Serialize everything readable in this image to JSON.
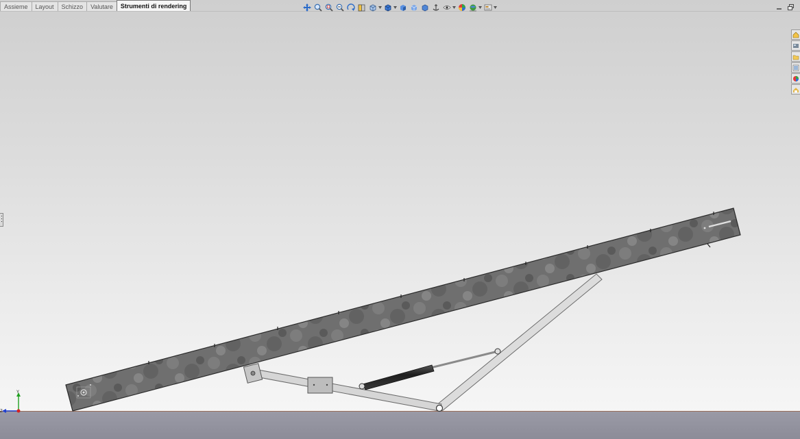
{
  "tabs": [
    {
      "label": "Assieme",
      "active": false
    },
    {
      "label": "Layout",
      "active": false
    },
    {
      "label": "Schizzo",
      "active": false
    },
    {
      "label": "Valutare",
      "active": false
    },
    {
      "label": "Strumenti di rendering",
      "active": true
    }
  ],
  "view_toolbar": {
    "icons": [
      "pan-icon",
      "zoom-to-fit-icon",
      "zoom-area-icon",
      "zoom-in-out-icon",
      "rotate-view-icon",
      "section-view-icon",
      "view-orientation-icon",
      "display-style-icon",
      "hide-show-icon",
      "appearance-icon",
      "scene-icon",
      "view-settings-icon"
    ]
  },
  "triad": {
    "x_label": "Z",
    "y_label": "Y"
  },
  "colors": {
    "beam": "#6e6e6e",
    "frame": "#d8d8d8",
    "floor": "#9a9aa6",
    "cylinder": "#2a2a2a",
    "axis_x": "#d62020",
    "axis_y": "#20a020",
    "axis_z": "#2040d0"
  }
}
